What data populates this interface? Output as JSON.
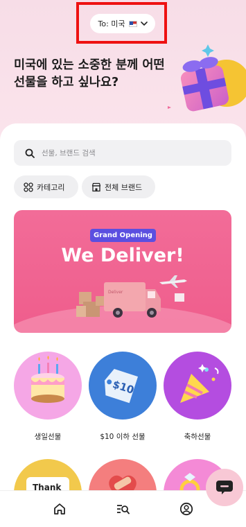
{
  "header": {
    "recipient_label": "To: 미국",
    "flag": "us-flag",
    "headline": "미국에 있는 소중한 분께 어떤 선물을 하고 싶나요?"
  },
  "search": {
    "placeholder": "선물, 브랜드 검색"
  },
  "chips": [
    {
      "label": "카테고리",
      "icon": "grid-icon"
    },
    {
      "label": "전체 브랜드",
      "icon": "store-icon"
    }
  ],
  "banner": {
    "badge": "Grand Opening",
    "title": "We Deliver!",
    "truck_text": "Deliver"
  },
  "categories": [
    {
      "label": "생일선물",
      "icon": "cake-icon",
      "color": "#f5a7e6"
    },
    {
      "label": "$10 이하 선물",
      "icon": "price-tag-icon",
      "color": "#3d7fd9",
      "tag": "$10"
    },
    {
      "label": "축하선물",
      "icon": "party-popper-icon",
      "color": "#b44de0"
    }
  ],
  "categories_row2": [
    {
      "icon": "thank-you-card-icon",
      "color": "#f2c94c",
      "text": "Thank"
    },
    {
      "icon": "heart-bandage-icon",
      "color": "#f47e7e"
    },
    {
      "icon": "ring-icon",
      "color": "#f48ad6"
    }
  ],
  "nav": [
    {
      "icon": "home-icon"
    },
    {
      "icon": "list-search-icon"
    },
    {
      "icon": "profile-icon"
    }
  ],
  "colors": {
    "accent": "#ef5d8c",
    "highlight": "#ee1111",
    "badge": "#5b4fe0"
  }
}
